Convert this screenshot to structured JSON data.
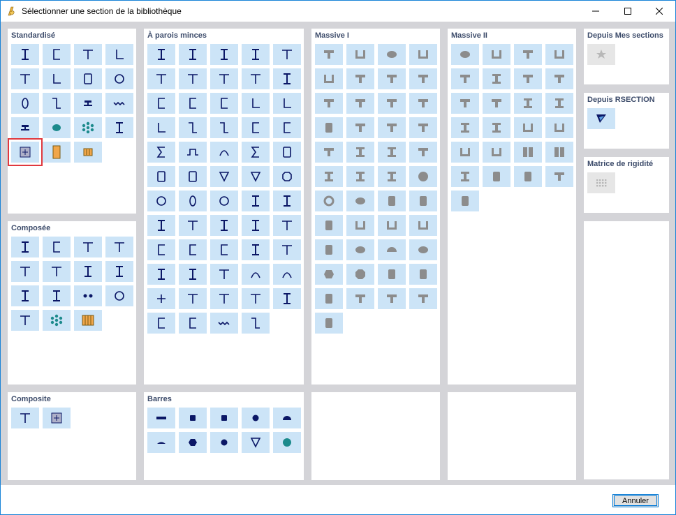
{
  "window": {
    "title": "Sélectionner une section de la bibliothèque",
    "controls": [
      "minimize",
      "maximize",
      "close"
    ]
  },
  "colors": {
    "button_bg": "#cce4f7",
    "shape_navy": "#0b1766",
    "shape_gray": "#8c8c8c",
    "accent_orange": "#f0a64a",
    "accent_teal": "#1c8a8c",
    "panel_bg": "#ffffff",
    "background": "#d4d4d8",
    "title_text": "#3c4b6a",
    "highlight_red": "#e0383e"
  },
  "panels": {
    "standardise": {
      "title": "Standardisé",
      "items": [
        {
          "icon": "i-section-icon",
          "style": "navy"
        },
        {
          "icon": "channel-section-icon",
          "style": "navy"
        },
        {
          "icon": "t-section-icon",
          "style": "navy"
        },
        {
          "icon": "angle-section-icon",
          "style": "navy"
        },
        {
          "icon": "half-t-section-icon",
          "style": "navy"
        },
        {
          "icon": "small-angle-section-icon",
          "style": "navy"
        },
        {
          "icon": "rectangular-tube-icon",
          "style": "navy"
        },
        {
          "icon": "circular-tube-icon",
          "style": "navy"
        },
        {
          "icon": "oval-tube-icon",
          "style": "navy"
        },
        {
          "icon": "z-section-icon",
          "style": "navy"
        },
        {
          "icon": "rail-section-icon",
          "style": "navy"
        },
        {
          "icon": "wave-section-icon",
          "style": "navy"
        },
        {
          "icon": "rail-head-icon",
          "style": "navy"
        },
        {
          "icon": "ellipse-teal-icon",
          "style": "teal"
        },
        {
          "icon": "strand-teal-icon",
          "style": "teal"
        },
        {
          "icon": "castellated-beam-icon",
          "style": "navy"
        },
        {
          "icon": "box-plus-icon",
          "style": "navy",
          "highlighted": true
        },
        {
          "icon": "orange-rectangle-icon",
          "style": "orange"
        },
        {
          "icon": "orange-io-icon",
          "style": "orange"
        }
      ]
    },
    "a_parois_minces": {
      "title": "À parois minces",
      "items": [
        {
          "icon": "i-thin-icon"
        },
        {
          "icon": "i-thin-icon"
        },
        {
          "icon": "i-thin-icon"
        },
        {
          "icon": "i-thin-icon"
        },
        {
          "icon": "t-thin-icon"
        },
        {
          "icon": "t-thin-icon"
        },
        {
          "icon": "t-thin-icon"
        },
        {
          "icon": "t-thin-icon"
        },
        {
          "icon": "double-t-thin-icon"
        },
        {
          "icon": "double-i-thin-icon"
        },
        {
          "icon": "channel-thin-icon"
        },
        {
          "icon": "channel-thin-icon"
        },
        {
          "icon": "channel-thin-icon"
        },
        {
          "icon": "angle-thin-icon"
        },
        {
          "icon": "angle-thin-icon"
        },
        {
          "icon": "angle-lip-thin-icon"
        },
        {
          "icon": "z-thin-icon"
        },
        {
          "icon": "z-thin-icon"
        },
        {
          "icon": "c-lip-thin-icon"
        },
        {
          "icon": "c-lip-thin-icon"
        },
        {
          "icon": "sigma-hook-thin-icon"
        },
        {
          "icon": "hat-thin-icon"
        },
        {
          "icon": "arch-thin-icon"
        },
        {
          "icon": "sigma-thin-icon"
        },
        {
          "icon": "square-tube-thin-icon"
        },
        {
          "icon": "rect-tube-thin-icon"
        },
        {
          "icon": "rect-tube-thick-icon"
        },
        {
          "icon": "triangle-down-thin-icon"
        },
        {
          "icon": "triangle-down-thin-icon"
        },
        {
          "icon": "octagon-thin-icon"
        },
        {
          "icon": "circle-thin-icon"
        },
        {
          "icon": "oval-thin-icon"
        },
        {
          "icon": "half-circle-thin-icon"
        },
        {
          "icon": "i-narrow-thin-icon"
        },
        {
          "icon": "i-narrow-thin-icon"
        },
        {
          "icon": "double-i-box-thin-icon"
        },
        {
          "icon": "t-thin-icon"
        },
        {
          "icon": "i-cross-thin-icon"
        },
        {
          "icon": "i-thin-icon"
        },
        {
          "icon": "t-thin-icon"
        },
        {
          "icon": "c-step-thin-icon"
        },
        {
          "icon": "c-step-thin-icon"
        },
        {
          "icon": "c-step-thin-icon"
        },
        {
          "icon": "double-i-thin-icon"
        },
        {
          "icon": "double-t-thin-icon"
        },
        {
          "icon": "i-bulb-thin-icon"
        },
        {
          "icon": "double-i-thin-icon"
        },
        {
          "icon": "double-t-thin-icon"
        },
        {
          "icon": "arch-tall-thin-icon"
        },
        {
          "icon": "arch-tall-thin-icon"
        },
        {
          "icon": "cross-thin-icon"
        },
        {
          "icon": "half-t-thin-icon"
        },
        {
          "icon": "double-t-thin-icon"
        },
        {
          "icon": "half-t-thin-icon"
        },
        {
          "icon": "i-wide-thin-icon"
        },
        {
          "icon": "double-c-thin-icon"
        },
        {
          "icon": "double-c-thin-icon"
        },
        {
          "icon": "wave-thin-icon"
        },
        {
          "icon": "trapez-sheet-icon"
        }
      ]
    },
    "massive_i": {
      "title": "Massive I",
      "items": [
        {
          "icon": "solid-rect-tall-icon"
        },
        {
          "icon": "solid-rounded-rect-icon"
        },
        {
          "icon": "solid-oval-tall-icon"
        },
        {
          "icon": "solid-square-icon"
        },
        {
          "icon": "solid-rounded-square-icon"
        },
        {
          "icon": "solid-trapezoid-icon"
        },
        {
          "icon": "solid-t-icon"
        },
        {
          "icon": "solid-t-icon"
        },
        {
          "icon": "solid-tapered-t-icon"
        },
        {
          "icon": "solid-t-flange-icon"
        },
        {
          "icon": "solid-t-flange-icon"
        },
        {
          "icon": "solid-t-offset-icon"
        },
        {
          "icon": "solid-l-flange-icon"
        },
        {
          "icon": "solid-cross-t-icon"
        },
        {
          "icon": "solid-double-t-icon"
        },
        {
          "icon": "solid-double-t-icon"
        },
        {
          "icon": "solid-double-t-tapered-icon"
        },
        {
          "icon": "solid-i-icon"
        },
        {
          "icon": "solid-i-icon"
        },
        {
          "icon": "solid-i-tapered-icon"
        },
        {
          "icon": "solid-i-icon"
        },
        {
          "icon": "solid-i-icon"
        },
        {
          "icon": "solid-i-icon"
        },
        {
          "icon": "solid-circle-icon"
        },
        {
          "icon": "solid-ring-icon"
        },
        {
          "icon": "solid-ellipse-icon"
        },
        {
          "icon": "solid-d-icon"
        },
        {
          "icon": "solid-l-icon"
        },
        {
          "icon": "solid-z-icon"
        },
        {
          "icon": "solid-u-icon"
        },
        {
          "icon": "solid-u-icon"
        },
        {
          "icon": "solid-u-wide-icon"
        },
        {
          "icon": "solid-rect-hollow-icon"
        },
        {
          "icon": "solid-oval-hollow-icon"
        },
        {
          "icon": "solid-half-circle-icon"
        },
        {
          "icon": "solid-half-ellipse-icon"
        },
        {
          "icon": "solid-hexagon-icon"
        },
        {
          "icon": "solid-octagon-icon"
        },
        {
          "icon": "solid-chamfer-rect-icon"
        },
        {
          "icon": "solid-notch-rect-icon"
        },
        {
          "icon": "solid-pointed-arch-icon"
        },
        {
          "icon": "solid-notch-top-icon"
        },
        {
          "icon": "solid-stepped-top-icon"
        },
        {
          "icon": "solid-stepped-top-icon"
        },
        {
          "icon": "solid-parallelogram-icon"
        }
      ]
    },
    "massive_ii": {
      "title": "Massive II",
      "items": [
        {
          "icon": "solid-oval-split-icon"
        },
        {
          "icon": "solid-double-rect-icon"
        },
        {
          "icon": "solid-triple-rect-icon"
        },
        {
          "icon": "solid-quad-rect-icon"
        },
        {
          "icon": "solid-double-t-flanged-icon"
        },
        {
          "icon": "solid-double-i-flanged-icon"
        },
        {
          "icon": "solid-t-icon"
        },
        {
          "icon": "solid-t-icon"
        },
        {
          "icon": "solid-pi-icon"
        },
        {
          "icon": "solid-pi-icon"
        },
        {
          "icon": "solid-i-icon"
        },
        {
          "icon": "solid-i-icon"
        },
        {
          "icon": "solid-i-wide-icon"
        },
        {
          "icon": "solid-i-box-icon"
        },
        {
          "icon": "solid-hollow-square-icon"
        },
        {
          "icon": "solid-hollow-square-icon"
        },
        {
          "icon": "solid-double-hollow-icon"
        },
        {
          "icon": "solid-double-hollow-icon"
        },
        {
          "icon": "solid-grid-2x2-icon"
        },
        {
          "icon": "solid-grid-3x3-icon"
        },
        {
          "icon": "solid-i-stiffened-icon"
        },
        {
          "icon": "solid-small-rect-icon"
        },
        {
          "icon": "solid-slot-rect-icon"
        },
        {
          "icon": "solid-slot-rect-tall-icon"
        },
        {
          "icon": "solid-v-shape-icon"
        }
      ]
    },
    "depuis_mes_sections": {
      "title": "Depuis Mes sections",
      "items": [
        {
          "icon": "star-icon"
        }
      ]
    },
    "depuis_rsection": {
      "title": "Depuis RSECTION",
      "items": [
        {
          "icon": "rsection-arrow-icon"
        }
      ]
    },
    "matrice_de_rigidite": {
      "title": "Matrice de rigidité",
      "items": [
        {
          "icon": "dot-matrix-icon"
        }
      ]
    },
    "composee": {
      "title": "Composée",
      "items": [
        {
          "icon": "double-i-composed-icon"
        },
        {
          "icon": "i-channel-composed-icon"
        },
        {
          "icon": "t-composed-icon"
        },
        {
          "icon": "t-composed-icon"
        },
        {
          "icon": "half-t-composed-icon"
        },
        {
          "icon": "double-t-composed-icon"
        },
        {
          "icon": "i-plate-composed-icon"
        },
        {
          "icon": "i-cross-composed-icon"
        },
        {
          "icon": "i-composed-icon"
        },
        {
          "icon": "i-composed-icon"
        },
        {
          "icon": "two-dots-icon"
        },
        {
          "icon": "two-circles-icon"
        },
        {
          "icon": "t-offset-composed-icon"
        },
        {
          "icon": "strand-teal-icon",
          "style": "teal"
        },
        {
          "icon": "orange-stripes-icon",
          "style": "orange"
        }
      ]
    },
    "composite": {
      "title": "Composite",
      "items": [
        {
          "icon": "t-slab-composite-icon"
        },
        {
          "icon": "box-plus-icon"
        }
      ]
    },
    "barres": {
      "title": "Barres",
      "items": [
        {
          "icon": "flat-bar-icon"
        },
        {
          "icon": "square-bar-icon"
        },
        {
          "icon": "rounded-square-bar-icon"
        },
        {
          "icon": "round-bar-icon"
        },
        {
          "icon": "half-round-bar-icon"
        },
        {
          "icon": "segment-bar-icon"
        },
        {
          "icon": "hexagon-bar-icon"
        },
        {
          "icon": "round-bar-icon"
        },
        {
          "icon": "triangle-bar-icon"
        },
        {
          "icon": "round-teal-bar-icon",
          "style": "teal"
        }
      ]
    }
  },
  "footer": {
    "cancel_label": "Annuler"
  }
}
